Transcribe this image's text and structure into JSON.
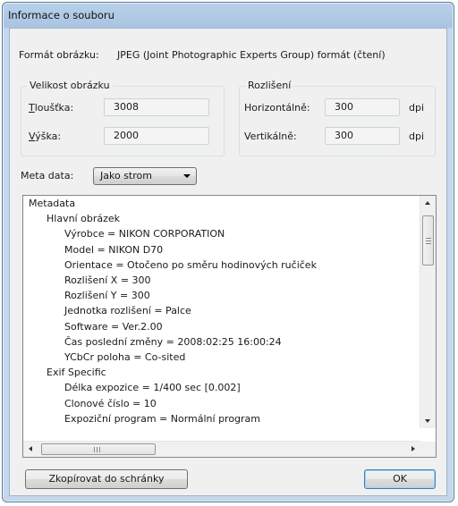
{
  "window": {
    "title": "Informace o souboru"
  },
  "format": {
    "label": "Formát obrázku:",
    "value": "JPEG (Joint Photographic Experts Group) formát (čtení)"
  },
  "size": {
    "group_title": "Velikost obrázku",
    "width_label": "Tloušťka:",
    "width_value": "3008",
    "height_label": "Výška:",
    "height_value": "2000"
  },
  "resolution": {
    "group_title": "Rozlišení",
    "horizontal_label": "Horizontálně:",
    "horizontal_value": "300",
    "horizontal_unit": "dpi",
    "vertical_label": "Vertikálně:",
    "vertical_value": "300",
    "vertical_unit": "dpi"
  },
  "meta": {
    "label": "Meta data:",
    "selected": "Jako strom"
  },
  "tree": {
    "lines": [
      "Metadata",
      "Hlavní obrázek",
      "Výrobce = NIKON CORPORATION",
      "Model = NIKON D70",
      "Orientace = Otočeno po směru hodinových ručiček",
      "Rozlišení X = 300",
      "Rozlišení Y = 300",
      "Jednotka rozlišení = Palce",
      "Software = Ver.2.00",
      "Čas poslední změny = 2008:02:25 16:00:24",
      "YCbCr poloha = Co-sited",
      "Exif Specific",
      "Délka expozice = 1/400 sec  [0.002]",
      "Clonové číslo = 10",
      "Expoziční program = Normální program"
    ]
  },
  "buttons": {
    "copy_label": "Zkopírovat do schránky",
    "ok_label": "OK"
  }
}
